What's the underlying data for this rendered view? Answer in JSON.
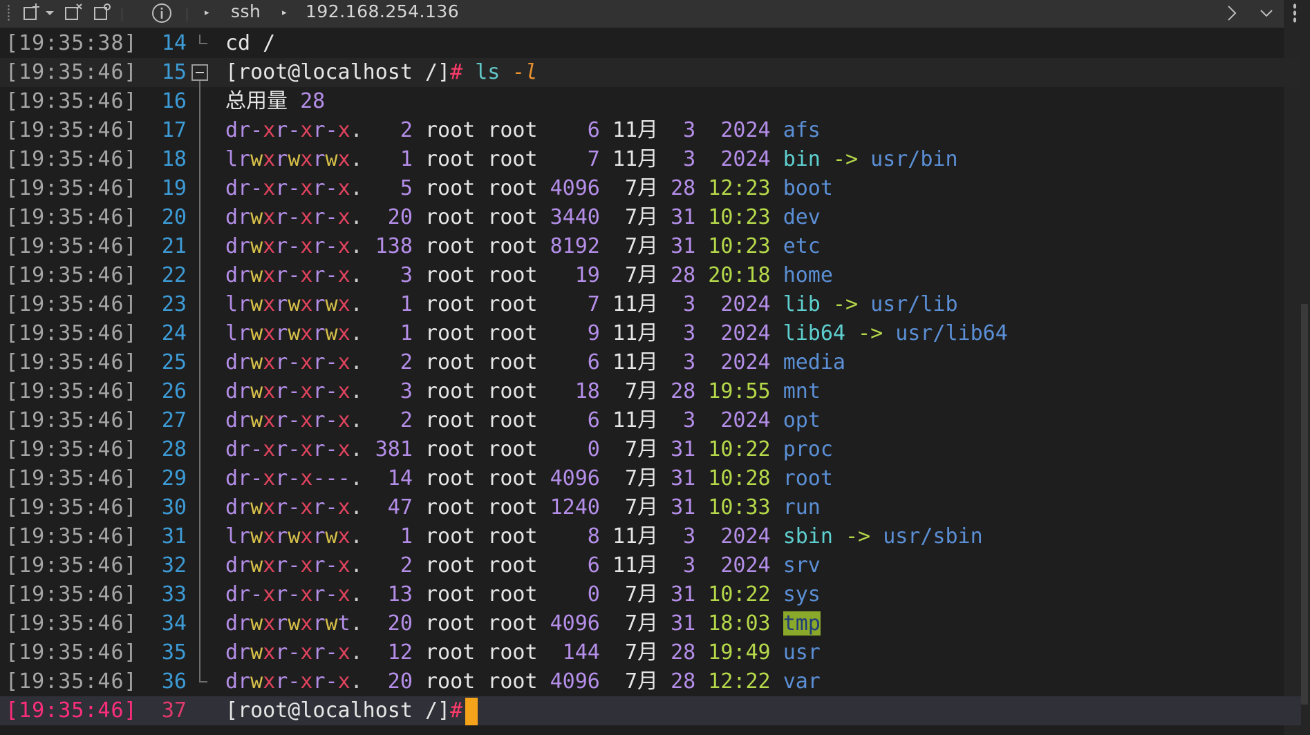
{
  "toolbar": {
    "icons": [
      "new-tab-icon",
      "dropdown-icon",
      "detach-icon",
      "new-window-icon",
      "info-icon"
    ],
    "breadcrumb": [
      "ssh",
      "192.168.254.136"
    ]
  },
  "terminal": {
    "lines": [
      {
        "ts": "[19:35:38]",
        "n": "14",
        "kind": "plain",
        "text": "cd /"
      },
      {
        "ts": "[19:35:46]",
        "n": "15",
        "kind": "cmd",
        "host": "[root@localhost /]",
        "hash": "#",
        "cmd": " ls ",
        "flag": "-l"
      },
      {
        "ts": "[19:35:46]",
        "n": "16",
        "kind": "total",
        "label": "总用量 ",
        "value": "28"
      },
      {
        "ts": "[19:35:46]",
        "n": "17",
        "kind": "entry",
        "perm": "dr-xr-xr-x",
        "links": "  2",
        "owner": "root",
        "group": "root",
        "size": "   6",
        "month": "11月",
        "day": "  3",
        "time": "  2024",
        "name": "afs",
        "ntype": "dir"
      },
      {
        "ts": "[19:35:46]",
        "n": "18",
        "kind": "entry",
        "perm": "lrwxrwxrwx",
        "links": "  1",
        "owner": "root",
        "group": "root",
        "size": "   7",
        "month": "11月",
        "day": "  3",
        "time": "  2024",
        "name": "bin",
        "ntype": "link",
        "target": "usr/bin"
      },
      {
        "ts": "[19:35:46]",
        "n": "19",
        "kind": "entry",
        "perm": "dr-xr-xr-x",
        "links": "  5",
        "owner": "root",
        "group": "root",
        "size": "4096",
        "month": " 7月",
        "day": " 28",
        "time": " 12:23",
        "name": "boot",
        "ntype": "dir"
      },
      {
        "ts": "[19:35:46]",
        "n": "20",
        "kind": "entry",
        "perm": "drwxr-xr-x",
        "links": " 20",
        "owner": "root",
        "group": "root",
        "size": "3440",
        "month": " 7月",
        "day": " 31",
        "time": " 10:23",
        "name": "dev",
        "ntype": "dir"
      },
      {
        "ts": "[19:35:46]",
        "n": "21",
        "kind": "entry",
        "perm": "drwxr-xr-x",
        "links": "138",
        "owner": "root",
        "group": "root",
        "size": "8192",
        "month": " 7月",
        "day": " 31",
        "time": " 10:23",
        "name": "etc",
        "ntype": "dir"
      },
      {
        "ts": "[19:35:46]",
        "n": "22",
        "kind": "entry",
        "perm": "drwxr-xr-x",
        "links": "  3",
        "owner": "root",
        "group": "root",
        "size": "  19",
        "month": " 7月",
        "day": " 28",
        "time": " 20:18",
        "name": "home",
        "ntype": "dir"
      },
      {
        "ts": "[19:35:46]",
        "n": "23",
        "kind": "entry",
        "perm": "lrwxrwxrwx",
        "links": "  1",
        "owner": "root",
        "group": "root",
        "size": "   7",
        "month": "11月",
        "day": "  3",
        "time": "  2024",
        "name": "lib",
        "ntype": "link",
        "target": "usr/lib"
      },
      {
        "ts": "[19:35:46]",
        "n": "24",
        "kind": "entry",
        "perm": "lrwxrwxrwx",
        "links": "  1",
        "owner": "root",
        "group": "root",
        "size": "   9",
        "month": "11月",
        "day": "  3",
        "time": "  2024",
        "name": "lib64",
        "ntype": "link",
        "target": "usr/lib64"
      },
      {
        "ts": "[19:35:46]",
        "n": "25",
        "kind": "entry",
        "perm": "drwxr-xr-x",
        "links": "  2",
        "owner": "root",
        "group": "root",
        "size": "   6",
        "month": "11月",
        "day": "  3",
        "time": "  2024",
        "name": "media",
        "ntype": "dir"
      },
      {
        "ts": "[19:35:46]",
        "n": "26",
        "kind": "entry",
        "perm": "drwxr-xr-x",
        "links": "  3",
        "owner": "root",
        "group": "root",
        "size": "  18",
        "month": " 7月",
        "day": " 28",
        "time": " 19:55",
        "name": "mnt",
        "ntype": "dir"
      },
      {
        "ts": "[19:35:46]",
        "n": "27",
        "kind": "entry",
        "perm": "drwxr-xr-x",
        "links": "  2",
        "owner": "root",
        "group": "root",
        "size": "   6",
        "month": "11月",
        "day": "  3",
        "time": "  2024",
        "name": "opt",
        "ntype": "dir"
      },
      {
        "ts": "[19:35:46]",
        "n": "28",
        "kind": "entry",
        "perm": "dr-xr-xr-x",
        "links": "381",
        "owner": "root",
        "group": "root",
        "size": "   0",
        "month": " 7月",
        "day": " 31",
        "time": " 10:22",
        "name": "proc",
        "ntype": "dir"
      },
      {
        "ts": "[19:35:46]",
        "n": "29",
        "kind": "entry",
        "perm": "dr-xr-x---",
        "links": " 14",
        "owner": "root",
        "group": "root",
        "size": "4096",
        "month": " 7月",
        "day": " 31",
        "time": " 10:28",
        "name": "root",
        "ntype": "dir"
      },
      {
        "ts": "[19:35:46]",
        "n": "30",
        "kind": "entry",
        "perm": "drwxr-xr-x",
        "links": " 47",
        "owner": "root",
        "group": "root",
        "size": "1240",
        "month": " 7月",
        "day": " 31",
        "time": " 10:33",
        "name": "run",
        "ntype": "dir"
      },
      {
        "ts": "[19:35:46]",
        "n": "31",
        "kind": "entry",
        "perm": "lrwxrwxrwx",
        "links": "  1",
        "owner": "root",
        "group": "root",
        "size": "   8",
        "month": "11月",
        "day": "  3",
        "time": "  2024",
        "name": "sbin",
        "ntype": "link",
        "target": "usr/sbin"
      },
      {
        "ts": "[19:35:46]",
        "n": "32",
        "kind": "entry",
        "perm": "drwxr-xr-x",
        "links": "  2",
        "owner": "root",
        "group": "root",
        "size": "   6",
        "month": "11月",
        "day": "  3",
        "time": "  2024",
        "name": "srv",
        "ntype": "dir"
      },
      {
        "ts": "[19:35:46]",
        "n": "33",
        "kind": "entry",
        "perm": "dr-xr-xr-x",
        "links": " 13",
        "owner": "root",
        "group": "root",
        "size": "   0",
        "month": " 7月",
        "day": " 31",
        "time": " 10:22",
        "name": "sys",
        "ntype": "dir"
      },
      {
        "ts": "[19:35:46]",
        "n": "34",
        "kind": "entry",
        "perm": "drwxrwxrwt",
        "links": " 20",
        "owner": "root",
        "group": "root",
        "size": "4096",
        "month": " 7月",
        "day": " 31",
        "time": " 18:03",
        "name": "tmp",
        "ntype": "tmp"
      },
      {
        "ts": "[19:35:46]",
        "n": "35",
        "kind": "entry",
        "perm": "drwxr-xr-x",
        "links": " 12",
        "owner": "root",
        "group": "root",
        "size": " 144",
        "month": " 7月",
        "day": " 28",
        "time": " 19:49",
        "name": "usr",
        "ntype": "dir"
      },
      {
        "ts": "[19:35:46]",
        "n": "36",
        "kind": "entry",
        "perm": "drwxr-xr-x",
        "links": " 20",
        "owner": "root",
        "group": "root",
        "size": "4096",
        "month": " 7月",
        "day": " 28",
        "time": " 12:22",
        "name": "var",
        "ntype": "dir"
      },
      {
        "ts": "[19:35:46]",
        "n": "37",
        "kind": "prompt",
        "host": "[root@localhost /]",
        "hash": "#"
      }
    ]
  },
  "colors": {
    "background": "#1e1e1e",
    "toolbar": "#323232",
    "timestamp": "#a6a6a6",
    "timestamp_active": "#ff2e7a",
    "line_number": "#3d9bd6",
    "directory": "#5b8fd6",
    "symlink": "#5fd0d0",
    "time": "#b6d94a",
    "cursor": "#f5a31a"
  }
}
